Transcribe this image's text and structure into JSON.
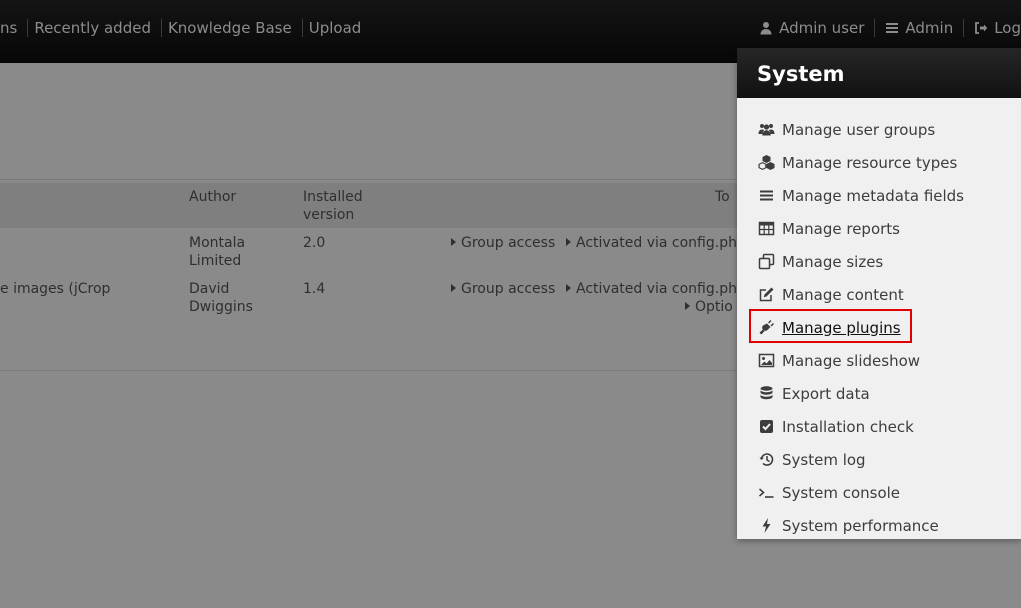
{
  "topnav": {
    "left": [
      "ns",
      "Recently added",
      "Knowledge Base",
      "Upload"
    ],
    "user": {
      "label": "Admin user",
      "icon": "user-icon"
    },
    "admin": {
      "label": "Admin",
      "icon": "bars-icon"
    },
    "logout": {
      "label": "Log",
      "icon": "sign-out-icon"
    }
  },
  "table": {
    "headers": {
      "author": "Author",
      "installed_line1": "Installed",
      "installed_line2": "version",
      "tools": "To"
    },
    "rows": [
      {
        "name": "",
        "author_line1": "Montala",
        "author_line2": "Limited",
        "version": "2.0",
        "tools": [
          "Group access",
          "Activated via config.ph"
        ]
      },
      {
        "name": "e images (jCrop",
        "author_line1": "David",
        "author_line2": "Dwiggins",
        "version": "1.4",
        "tools": [
          "Group access",
          "Activated via config.ph",
          "Optio"
        ]
      }
    ]
  },
  "system_menu": {
    "title": "System",
    "items": [
      {
        "label": "Manage user groups",
        "icon": "users-icon"
      },
      {
        "label": "Manage resource types",
        "icon": "cubes-icon"
      },
      {
        "label": "Manage metadata fields",
        "icon": "bars-icon"
      },
      {
        "label": "Manage reports",
        "icon": "table-icon"
      },
      {
        "label": "Manage sizes",
        "icon": "clone-icon"
      },
      {
        "label": "Manage content",
        "icon": "edit-icon"
      },
      {
        "label": "Manage plugins",
        "icon": "plug-icon"
      },
      {
        "label": "Manage slideshow",
        "icon": "image-icon"
      },
      {
        "label": "Export data",
        "icon": "database-icon"
      },
      {
        "label": "Installation check",
        "icon": "check-square-icon"
      },
      {
        "label": "System log",
        "icon": "history-icon"
      },
      {
        "label": "System console",
        "icon": "terminal-icon"
      },
      {
        "label": "System performance",
        "icon": "bolt-icon"
      }
    ],
    "active_item": "Manage plugins"
  },
  "colors": {
    "highlight": "#e00000",
    "topbar": "#111111",
    "panel": "#f0f0f0"
  }
}
